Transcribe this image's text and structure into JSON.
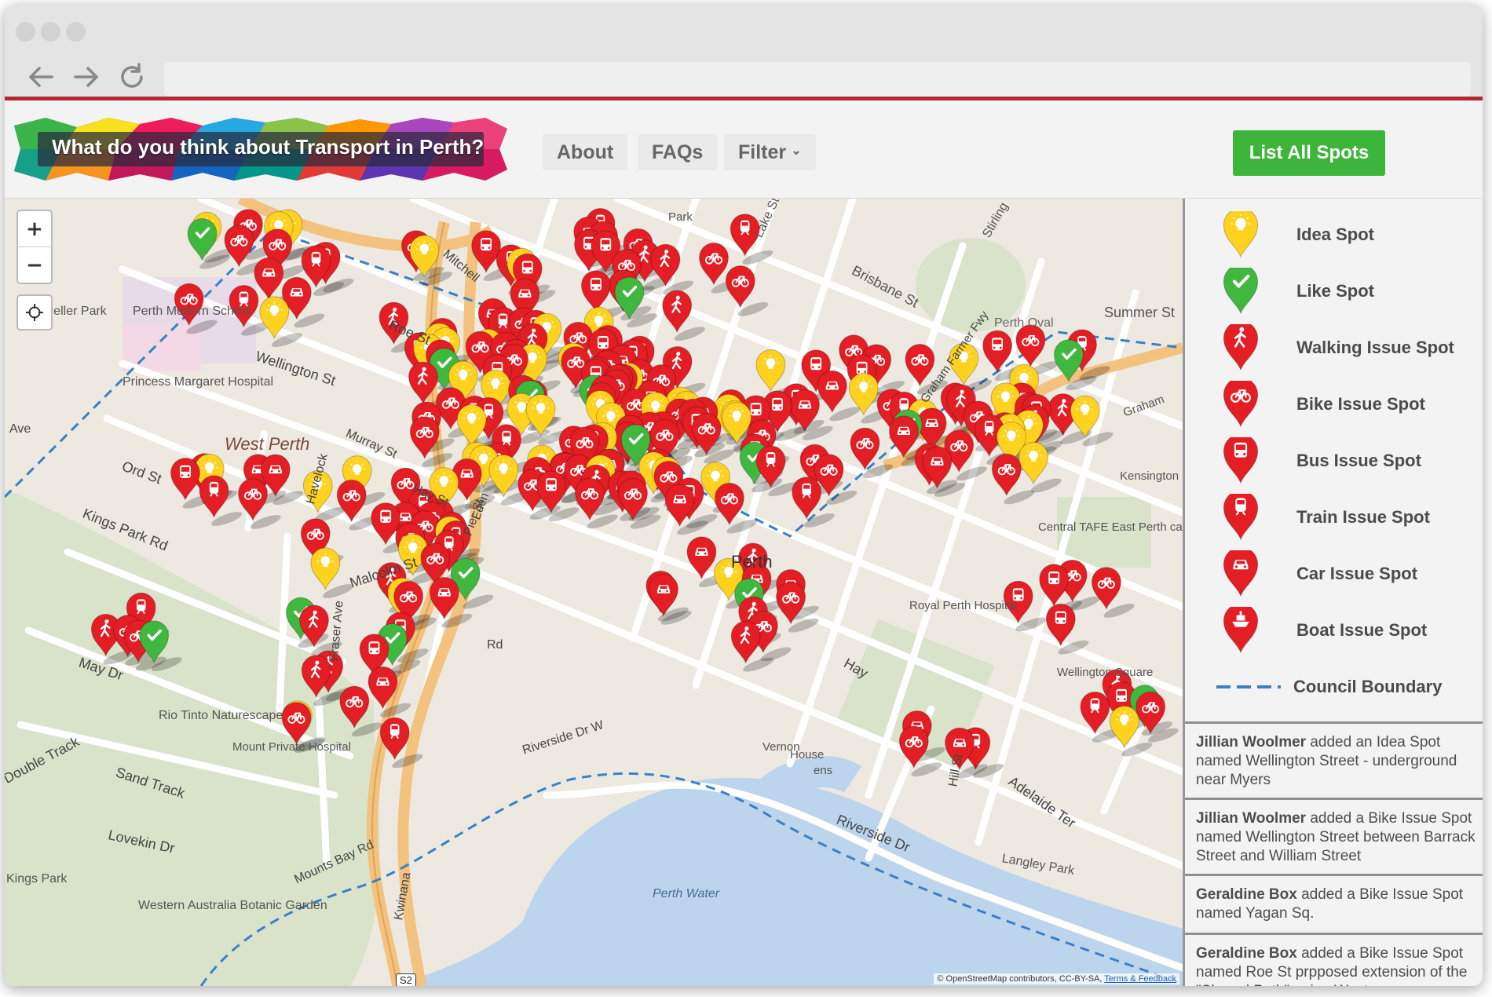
{
  "browser": {
    "back_icon": "arrow-left-icon",
    "forward_icon": "arrow-right-icon",
    "reload_icon": "reload-icon",
    "url": ""
  },
  "header": {
    "logo_text": "What do you think about Transport in Perth?",
    "nav": [
      "About",
      "FAQs",
      "Filter"
    ],
    "list_button": "List All Spots",
    "accent_color": "#b3282d",
    "button_color": "#3db43a"
  },
  "map": {
    "zoom_in": "+",
    "zoom_out": "−",
    "labels": [
      "Perth Oval",
      "Summer St",
      "Brisbane St",
      "Lake St",
      "Stirling",
      "Wellington St",
      "Roe St",
      "West Perth",
      "Ord St",
      "Hay St",
      "Kings Park Rd",
      "Malcolm St",
      "May Dr",
      "Fraser Ave",
      "Rio Tinto Naturescape",
      "Mount Private Hospital",
      "Sand Track",
      "Double Track",
      "Lovekin Dr",
      "Kings Park",
      "Western Australia Botanic Garden",
      "Mounts Bay Rd",
      "Riverside Dr W",
      "Perth Water",
      "Riverside Dr",
      "Langley Park",
      "Adelaide Ter",
      "Hill St",
      "Wellington Square",
      "Central TAFE East Perth campus",
      "Kensington",
      "Graham",
      "Princess Margaret Hospital",
      "Perth Modern School",
      "Mueller Park",
      "Park",
      "Mitchell",
      "Havelock",
      "Ave",
      "Murray St",
      "Pier St",
      "Perth",
      "Vernon",
      "Royal Perth Hospital",
      "Kwinana",
      "S2",
      "Eden",
      "Graham Farmer Fwy",
      "Hay",
      "Rd",
      "ens",
      "House"
    ],
    "attribution": "© OpenStreetMap contributors, CC-BY-SA,",
    "attribution_link": "Terms & Feedback",
    "colors": {
      "water": "#bcd5ec",
      "park": "#d9e3c9",
      "road": "#ffffff",
      "freeway": "#f2c27e",
      "boundary": "#3b7fc4",
      "red_marker": "#e31e24",
      "yellow_marker": "#ffd21f",
      "green_marker": "#40b73f"
    }
  },
  "legend": [
    {
      "label": "Idea Spot",
      "icon": "lightbulb-icon",
      "color": "#ffd21f"
    },
    {
      "label": "Like Spot",
      "icon": "checkmark-icon",
      "color": "#40b73f"
    },
    {
      "label": "Walking Issue Spot",
      "icon": "walking-icon",
      "color": "#e31e24"
    },
    {
      "label": "Bike Issue Spot",
      "icon": "bike-icon",
      "color": "#e31e24"
    },
    {
      "label": "Bus Issue Spot",
      "icon": "bus-icon",
      "color": "#e31e24"
    },
    {
      "label": "Train Issue Spot",
      "icon": "train-icon",
      "color": "#e31e24"
    },
    {
      "label": "Car Issue Spot",
      "icon": "car-icon",
      "color": "#e31e24"
    },
    {
      "label": "Boat Issue Spot",
      "icon": "boat-icon",
      "color": "#e31e24"
    },
    {
      "label": "Council Boundary",
      "icon": "dashed-line-icon",
      "color": "#3b7fc4"
    }
  ],
  "feed": [
    {
      "user": "Jillian Woolmer",
      "text_lines": [
        "added an Idea Spot",
        "named Wellington Street - underground",
        "near Myers"
      ]
    },
    {
      "user": "Jillian Woolmer",
      "text_lines": [
        "added a Bike Issue Spot",
        "named Wellington Street between Barrack",
        "Street and William Street"
      ]
    },
    {
      "user": "Geraldine Box",
      "text_lines": [
        "added a Bike Issue Spot",
        "named Yagan Sq."
      ]
    },
    {
      "user": "Geraldine Box",
      "text_lines": [
        "added a Bike Issue Spot",
        "named Roe St prpposed extension of the",
        "\"Shared Path\" going West"
      ]
    }
  ]
}
